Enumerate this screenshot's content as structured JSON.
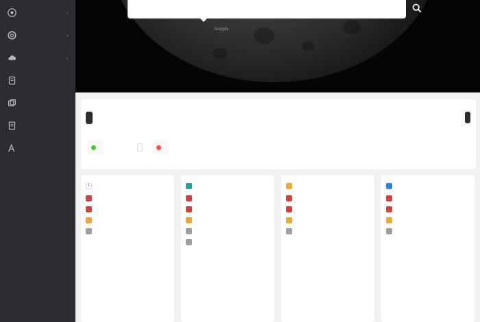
{
  "sidebar": {
    "items": [
      {
        "label": "",
        "icon": "grid-icon",
        "has_arrow": true
      },
      {
        "label": "",
        "icon": "lifebuoy-icon",
        "has_arrow": true
      },
      {
        "label": "",
        "icon": "cloud-icon",
        "has_arrow": true
      },
      {
        "label": "",
        "icon": "tablet-icon",
        "has_arrow": false
      },
      {
        "label": "",
        "icon": "layers-icon",
        "has_arrow": false
      },
      {
        "label": "",
        "icon": "book-icon",
        "has_arrow": false
      },
      {
        "label": "",
        "icon": "font-icon",
        "has_arrow": false
      }
    ],
    "arrow": "›"
  },
  "hero": {
    "search_placeholder": "",
    "search_icon": "search-icon",
    "engines": [
      "",
      "Google",
      "",
      "",
      "",
      ""
    ]
  },
  "main": {
    "tabs": {
      "active": "",
      "other": ""
    },
    "tag_button": "",
    "chips": [
      {
        "label": "",
        "color": "#52c41a"
      },
      {
        "label": "",
        "color": "#ff4d4f"
      }
    ]
  },
  "cards": [
    {
      "title": "",
      "more": "",
      "logo_color": "#ffffff",
      "news": [
        {
          "badge": "",
          "color": "#e53935",
          "text": ""
        },
        {
          "badge": "",
          "color": "#e53935",
          "text": ""
        },
        {
          "badge": "",
          "color": "#f5a623",
          "text": ""
        },
        {
          "badge": "",
          "color": "#9e9e9e",
          "text": ""
        }
      ],
      "foot_left": "",
      "foot_right": ""
    },
    {
      "title": "",
      "more": "",
      "logo_color": "#19a7a0",
      "news": [
        {
          "badge": "",
          "color": "#e53935",
          "text": ""
        },
        {
          "badge": "",
          "color": "#e53935",
          "text": ""
        },
        {
          "badge": "",
          "color": "#f5a623",
          "text": ""
        },
        {
          "badge": "",
          "color": "#9e9e9e",
          "text": ""
        },
        {
          "badge": "",
          "color": "#9e9e9e",
          "text": ""
        }
      ],
      "foot_left": "",
      "foot_right": ""
    },
    {
      "title": "",
      "more": "",
      "logo_color": "#f5a623",
      "news": [
        {
          "badge": "",
          "color": "#e53935",
          "text": ""
        },
        {
          "badge": "",
          "color": "#e53935",
          "text": ""
        },
        {
          "badge": "",
          "color": "#f5a623",
          "text": ""
        },
        {
          "badge": "",
          "color": "#9e9e9e",
          "text": ""
        }
      ],
      "foot_left": "",
      "foot_right": ""
    },
    {
      "title": "",
      "more": "",
      "logo_color": "#1e88e5",
      "news": [
        {
          "badge": "",
          "color": "#e53935",
          "text": ""
        },
        {
          "badge": "",
          "color": "#e53935",
          "text": ""
        },
        {
          "badge": "",
          "color": "#f5a623",
          "text": ""
        },
        {
          "badge": "",
          "color": "#9e9e9e",
          "text": ""
        }
      ],
      "foot_left": "",
      "foot_right": ""
    }
  ]
}
